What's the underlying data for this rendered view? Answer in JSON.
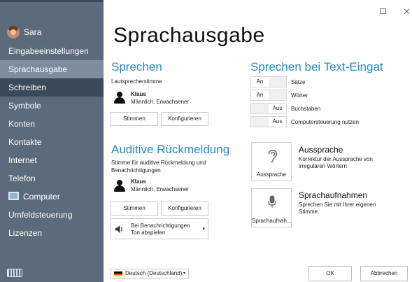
{
  "window": {
    "maximize_glyph": "☐",
    "close_glyph": "✕"
  },
  "sidebar": {
    "user_name": "Sara",
    "items": [
      {
        "label": "Eingabeeinstellungen"
      },
      {
        "label": "Sprachausgabe"
      },
      {
        "label": "Schreiben"
      },
      {
        "label": "Symbole"
      },
      {
        "label": "Konten"
      },
      {
        "label": "Kontakte"
      },
      {
        "label": "Internet"
      },
      {
        "label": "Telefon"
      },
      {
        "label": "Computer"
      },
      {
        "label": "Umfeldsteuerung"
      },
      {
        "label": "Lizenzen"
      }
    ],
    "active_index": 1
  },
  "page": {
    "title": "Sprachausgabe"
  },
  "sprechen": {
    "title": "Sprechen",
    "subtitle": "Lautsprecherstimme",
    "voice_name": "Klaus",
    "voice_desc": "Männlich, Erwachsener",
    "voices_button": "Stimmen",
    "configure_button": "Konfigurieren"
  },
  "auditive": {
    "title": "Auditive Rückmeldung",
    "subtitle": "Stimme für auditive Rückmeldung und Benachrichtigungen",
    "voice_name": "Klaus",
    "voice_desc": "Männlich, Erwachsener",
    "voices_button": "Stimmen",
    "configure_button": "Konfigurieren",
    "dropdown_line1": "Bei Benachrichtigungen",
    "dropdown_line2": "Ton abspielen",
    "dropdown_arrow": "▾"
  },
  "text_input": {
    "title": "Sprechen bei Text-Eingat",
    "toggles": [
      {
        "state": "An",
        "label": "Sätze"
      },
      {
        "state": "An",
        "label": "Wörter"
      },
      {
        "state": "Aus",
        "label": "Buchstaben"
      },
      {
        "state": "Aus",
        "label": "Computersteuerung nutzen"
      }
    ]
  },
  "pronunciation": {
    "tile_label": "Aussprache",
    "title": "Aussprache",
    "desc_line1": "Korrektur der Aussprache von",
    "desc_line2": "irregulären Wörtern"
  },
  "recordings": {
    "tile_label": "Sprachaufnah...",
    "title": "Sprachaufnahmen",
    "desc_line1": "Sprechen Sie mit Ihrer eigenen",
    "desc_line2": "Stimme."
  },
  "footer": {
    "language": "Deutsch (Deutschland)",
    "language_arrow": "▾",
    "ok": "OK",
    "cancel": "Abbrechen"
  },
  "colors": {
    "sidebar_bg": "#5b6b7b",
    "accent": "#2a88c8",
    "active_item": "#7d8d9d",
    "hover_item": "#3b4a59"
  }
}
